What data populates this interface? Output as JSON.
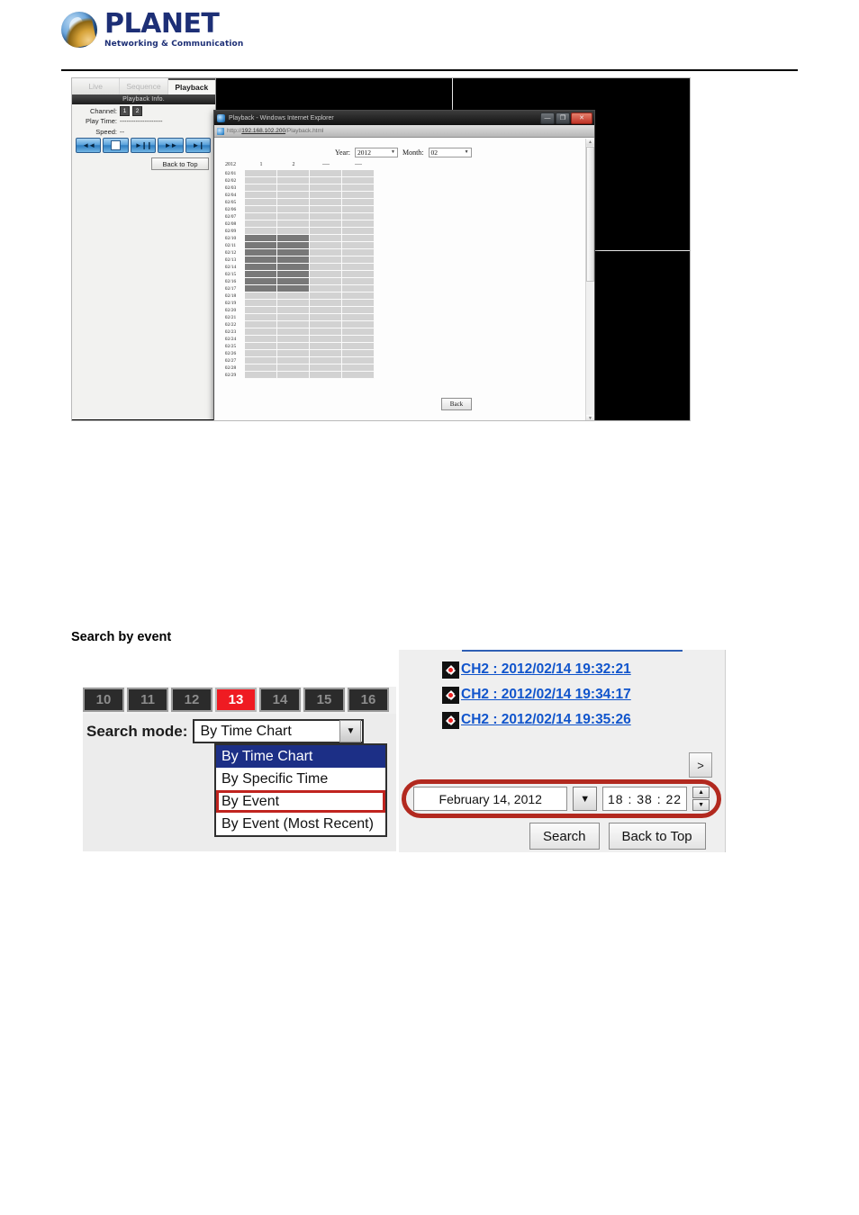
{
  "header": {
    "brand": "PLANET",
    "tagline": "Networking & Communication",
    "logo_icon": "planet-globe-logo"
  },
  "figure_playback": {
    "tabs": [
      {
        "label": "Live",
        "active": false
      },
      {
        "label": "Sequence",
        "active": false
      },
      {
        "label": "Playback",
        "active": true
      }
    ],
    "info_bar_title": "Playback Info.",
    "info": {
      "channel_label": "Channel:",
      "channels": [
        "1",
        "2"
      ],
      "playtime_label": "Play Time:",
      "playtime_value": "-------------------",
      "speed_label": "Speed:",
      "speed_value": "--"
    },
    "controls": [
      {
        "name": "rewind-button",
        "glyph": "◄◄"
      },
      {
        "name": "stop-button",
        "glyph": ""
      },
      {
        "name": "play-pause-button",
        "glyph": "►❙❙"
      },
      {
        "name": "fast-forward-button",
        "glyph": "►►"
      },
      {
        "name": "next-frame-button",
        "glyph": "►❙"
      }
    ],
    "back_to_top_label": "Back to Top",
    "ie_window": {
      "title": "Playback - Windows Internet Explorer",
      "url_prefix": "http://",
      "url_host": "192.168.102.200",
      "url_path": "/Playback.html",
      "minimize_label": "—",
      "maximize_label": "❐",
      "close_label": "✕"
    },
    "time_chart": {
      "year_label": "Year:",
      "year_value": "2012",
      "month_label": "Month:",
      "month_value": "02",
      "header": [
        "2012",
        "1",
        "2",
        "----",
        "----"
      ],
      "rows": [
        {
          "label": "02/01",
          "cells": [
            0,
            0,
            0,
            0
          ]
        },
        {
          "label": "02/02",
          "cells": [
            0,
            0,
            0,
            0
          ]
        },
        {
          "label": "02/03",
          "cells": [
            0,
            0,
            0,
            0
          ]
        },
        {
          "label": "02/04",
          "cells": [
            0,
            0,
            0,
            0
          ]
        },
        {
          "label": "02/05",
          "cells": [
            0,
            0,
            0,
            0
          ]
        },
        {
          "label": "02/06",
          "cells": [
            0,
            0,
            0,
            0
          ]
        },
        {
          "label": "02/07",
          "cells": [
            0,
            0,
            0,
            0
          ]
        },
        {
          "label": "02/08",
          "cells": [
            0,
            0,
            0,
            0
          ]
        },
        {
          "label": "02/09",
          "cells": [
            0,
            0,
            0,
            0
          ]
        },
        {
          "label": "02/10",
          "cells": [
            1,
            1,
            0,
            0
          ]
        },
        {
          "label": "02/11",
          "cells": [
            1,
            1,
            0,
            0
          ]
        },
        {
          "label": "02/12",
          "cells": [
            1,
            1,
            0,
            0
          ]
        },
        {
          "label": "02/13",
          "cells": [
            1,
            1,
            0,
            0
          ]
        },
        {
          "label": "02/14",
          "cells": [
            1,
            1,
            0,
            0
          ]
        },
        {
          "label": "02/15",
          "cells": [
            1,
            1,
            0,
            0
          ]
        },
        {
          "label": "02/16",
          "cells": [
            1,
            1,
            0,
            0
          ]
        },
        {
          "label": "02/17",
          "cells": [
            1,
            1,
            0,
            0
          ]
        },
        {
          "label": "02/18",
          "cells": [
            0,
            0,
            0,
            0
          ]
        },
        {
          "label": "02/19",
          "cells": [
            0,
            0,
            0,
            0
          ]
        },
        {
          "label": "02/20",
          "cells": [
            0,
            0,
            0,
            0
          ]
        },
        {
          "label": "02/21",
          "cells": [
            0,
            0,
            0,
            0
          ]
        },
        {
          "label": "02/22",
          "cells": [
            0,
            0,
            0,
            0
          ]
        },
        {
          "label": "02/23",
          "cells": [
            0,
            0,
            0,
            0
          ]
        },
        {
          "label": "02/24",
          "cells": [
            0,
            0,
            0,
            0
          ]
        },
        {
          "label": "02/25",
          "cells": [
            0,
            0,
            0,
            0
          ]
        },
        {
          "label": "02/26",
          "cells": [
            0,
            0,
            0,
            0
          ]
        },
        {
          "label": "02/27",
          "cells": [
            0,
            0,
            0,
            0
          ]
        },
        {
          "label": "02/28",
          "cells": [
            0,
            0,
            0,
            0
          ]
        },
        {
          "label": "02/29",
          "cells": [
            0,
            0,
            0,
            0
          ]
        }
      ],
      "back_label": "Back"
    }
  },
  "section": {
    "heading": "Search by event"
  },
  "figure_searchmode": {
    "channel_buttons": [
      {
        "label": "10",
        "active": false
      },
      {
        "label": "11",
        "active": false
      },
      {
        "label": "12",
        "active": false
      },
      {
        "label": "13",
        "active": true
      },
      {
        "label": "14",
        "active": false
      },
      {
        "label": "15",
        "active": false
      },
      {
        "label": "16",
        "active": false
      }
    ],
    "active_channel_color": "#ef1b22",
    "search_mode_label": "Search mode:",
    "search_mode_value": "By Time Chart",
    "options": [
      {
        "label": "By Time Chart",
        "selected": true,
        "highlighted": false
      },
      {
        "label": "By Specific Time",
        "selected": false,
        "highlighted": false
      },
      {
        "label": "By Event",
        "selected": false,
        "highlighted": true
      },
      {
        "label": "By Event (Most Recent)",
        "selected": false,
        "highlighted": false
      }
    ],
    "highlight_box_color": "#c0241f"
  },
  "figure_eventpanel": {
    "events": [
      {
        "icon": "motion-detection-icon",
        "label": "CH2 : 2012/02/14 19:32:21"
      },
      {
        "icon": "motion-detection-icon",
        "label": "CH2 : 2012/02/14 19:34:17"
      },
      {
        "icon": "motion-detection-icon",
        "label": "CH2 : 2012/02/14 19:35:26"
      }
    ],
    "link_color": "#1155cc",
    "next_page_label": ">",
    "date_value": "February 14, 2012",
    "date_dropdown_glyph": "▼",
    "time_value": "18 : 38 : 22",
    "spinner_up_glyph": "▲",
    "spinner_down_glyph": "▼",
    "search_button_label": "Search",
    "back_to_top_button_label": "Back to Top",
    "highlight_box_color": "#b2291f"
  }
}
